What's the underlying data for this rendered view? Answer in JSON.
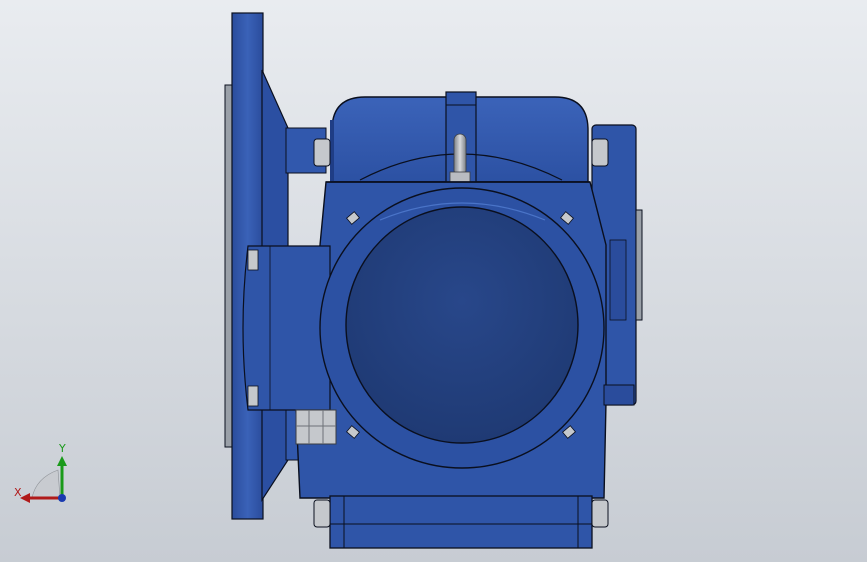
{
  "viewport": {
    "background_top": "#e9ecf0",
    "background_bottom": "#c7ccd3"
  },
  "model": {
    "body_color": "#2f55a8",
    "body_dark": "#1f3d85",
    "face_color": "#233f7c",
    "edge_color": "#0a0f1e",
    "metal_color": "#b9bcc1"
  },
  "triad": {
    "x_label": "X",
    "y_label": "Y",
    "x_color": "#b01a1a",
    "y_color": "#1a9a1a",
    "z_color": "#1a3ab0"
  }
}
